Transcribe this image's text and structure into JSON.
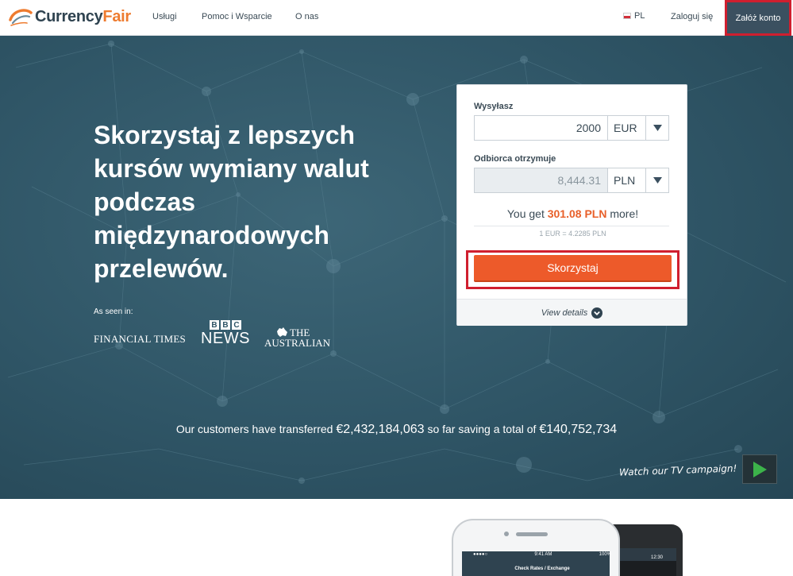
{
  "brand": {
    "name_part1": "Currency",
    "name_part2": "Fair",
    "accent_color": "#ee7b2f"
  },
  "nav": {
    "links": [
      "Usługi",
      "Pomoc i Wsparcie",
      "O nas"
    ],
    "language": "PL",
    "login": "Zaloguj się",
    "signup": "Załóż konto"
  },
  "hero": {
    "headline": "Skorzystaj z lepszych kursów wymiany walut podczas międzynarodowych przelewów.",
    "as_seen_in": "As seen in:",
    "press": {
      "ft": "FINANCIAL TIMES",
      "bbc_letters": [
        "B",
        "B",
        "C"
      ],
      "bbc_news": "NEWS",
      "australian_line1": "THE",
      "australian_line2": "AUSTRALIAN"
    },
    "stats": {
      "prefix": "Our customers have transferred",
      "transferred": "€2,432,184,063",
      "middle": "so far saving a total of",
      "saved": "€140,752,734"
    },
    "tv_campaign": "Watch our TV campaign!"
  },
  "converter": {
    "send_label": "Wysyłasz",
    "send_amount": "2000",
    "send_currency": "EUR",
    "receive_label": "Odbiorca otrzymuje",
    "receive_amount": "8,444.31",
    "receive_currency": "PLN",
    "you_get_prefix": "You get",
    "you_get_value": "301.08 PLN",
    "you_get_suffix": "more!",
    "rate": "1 EUR = 4.2285 PLN",
    "cta": "Skorzystaj",
    "view_details": "View details"
  },
  "phone": {
    "ios_time": "9:41 AM",
    "ios_battery": "100%",
    "ios_title": "Check Rates / Exchange",
    "android_time": "12:30"
  }
}
